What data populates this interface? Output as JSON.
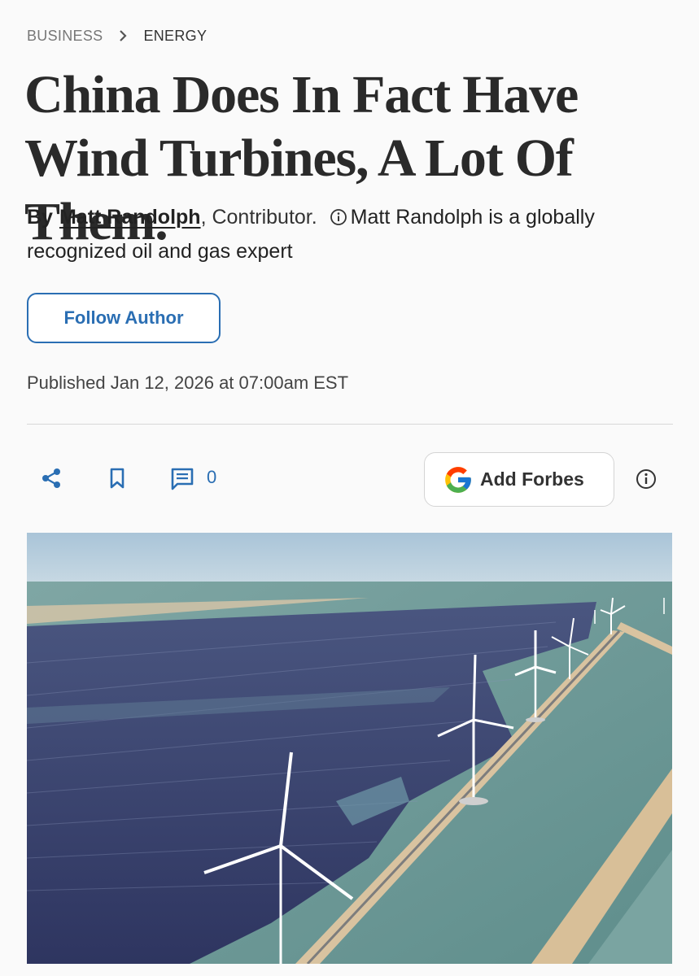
{
  "breadcrumb": {
    "section": "BUSINESS",
    "subsection": "ENERGY"
  },
  "article": {
    "title": "China Does In Fact Have Wind Turbines, A Lot Of Them.",
    "by_label": "By",
    "author": "Matt Randolph",
    "role": ", Contributor.",
    "author_bio": "Matt Randolph is a globally recognized oil and gas expert",
    "published": "Published Jan 12, 2026 at 07:00am EST"
  },
  "actions": {
    "follow_label": "Follow Author",
    "comment_count": "0",
    "add_forbes_label": "Add Forbes"
  },
  "icons": {
    "chevron": "chevron-right-icon",
    "info": "info-icon",
    "share": "share-icon",
    "bookmark": "bookmark-icon",
    "comment": "comment-icon",
    "google": "google-logo-icon"
  },
  "colors": {
    "accent": "#2a6eb3",
    "text": "#222222",
    "muted": "#777777"
  }
}
